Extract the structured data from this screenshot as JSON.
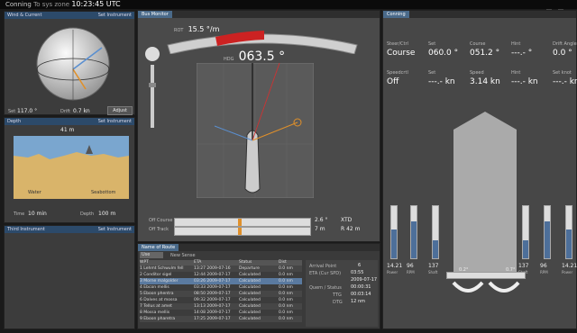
{
  "app": {
    "title": "Conning",
    "tz": "To sys zone",
    "time": "10:23:45 UTC"
  },
  "left": {
    "wind": {
      "header": "Wind & Current",
      "set_instr": "Set Instrument",
      "set_label": "Set",
      "set_value": "117.0 °",
      "drift_label": "Drift",
      "drift_value": "0.7 kn",
      "adjust": "Adjust"
    },
    "depth": {
      "header": "Depth",
      "set_instr": "Set Instrument",
      "depth_value": "41 m",
      "label_left": "Water",
      "label_right": "Seabottom",
      "time_label": "Time",
      "time_value": "10 min",
      "depth_label": "Depth",
      "depth_bottom": "100 m"
    },
    "third": {
      "header": "Third Instrument",
      "set_instr": "Set Instrument"
    }
  },
  "center": {
    "tab": "Bus Monitor",
    "rot": {
      "label": "ROT",
      "value": "15.5 °/m"
    },
    "heading": {
      "label": "HDG",
      "value": "063.5 °"
    },
    "xtd": {
      "off_course_label": "Off Course",
      "off_track_label": "Off Track",
      "course_val": "2.6 °",
      "track_val": "7 m",
      "xtd_label": "XTD",
      "xtd_val": "R 42 m"
    },
    "route": {
      "tab": "Name of Route",
      "dropdown": "Use",
      "header_label": "New Sense",
      "columns": [
        "WPT",
        "ETA",
        "Status",
        "Dist"
      ],
      "rows": [
        [
          "1 Lehmt Schwulm fell",
          "13:27 2009-07-16",
          "Departure",
          "0.0 nm"
        ],
        [
          "2 Conditor sigel",
          "12:44 2009-07-17",
          "Calculated",
          "0.0 nm"
        ],
        [
          "3 Morne malgolder",
          "03:26 2009-07-17",
          "Calculated",
          "0.0 nm"
        ],
        [
          "4 Ebcon mellis",
          "03:33 2009-07-17",
          "Calculated",
          "0.0 nm"
        ],
        [
          "5 Eboon phentra",
          "08:50 2009-07-17",
          "Calculated",
          "0.0 nm"
        ],
        [
          "6 Dalves at mossa",
          "09:32 2009-07-17",
          "Calculated",
          "0.0 nm"
        ],
        [
          "7 Tellus at amet",
          "13:13 2009-07-17",
          "Calculated",
          "0.0 nm"
        ],
        [
          "8 Mossa mellis",
          "14:08 2009-07-17",
          "Calculated",
          "0.0 nm"
        ],
        [
          "9 Eboon pharetra",
          "17:25 2009-07-17",
          "Calculated",
          "0.0 nm"
        ]
      ],
      "side": {
        "arrival_label": "Arrival Point",
        "arrival_val": "6",
        "eta_label": "ETA (Cur SPD)",
        "eta_val": "03:55",
        "date_val": "2009-07-17",
        "dur_label": "Quem / Status",
        "dur_val": "00:00:31",
        "ttg_label": "TTG",
        "ttg_val": "00:03:14",
        "dtg_label": "DTG",
        "dtg_val": "12 nm"
      }
    }
  },
  "right": {
    "tab": "Conning",
    "row1": [
      {
        "label": "Steer/Ctrl",
        "value": "Course"
      },
      {
        "label": "Set",
        "value": "060.0 °"
      },
      {
        "label": "Course",
        "value": "051.2 °"
      },
      {
        "label": "Hint",
        "value": "---.- °"
      },
      {
        "label": "Drift Angle",
        "value": "0.0 °"
      }
    ],
    "row2": [
      {
        "label": "Speedcrtl",
        "value": "Off"
      },
      {
        "label": "Set",
        "value": "---.- kn"
      },
      {
        "label": "Speed",
        "value": "3.14 kn"
      },
      {
        "label": "Hint",
        "value": "---.- kn"
      },
      {
        "label": "Set knot",
        "value": "---.- kn"
      }
    ],
    "gauges": [
      {
        "value": "14.21",
        "label": "Power",
        "fill": 0.55
      },
      {
        "value": "96",
        "label": "RPM",
        "fill": 0.7
      },
      {
        "value": "137",
        "label": "Shaft",
        "fill": 0.35
      },
      {
        "value": "137",
        "label": "Shaft",
        "fill": 0.35
      },
      {
        "value": "96",
        "label": "RPM",
        "fill": 0.7
      },
      {
        "value": "14.21",
        "label": "Power",
        "fill": 0.55
      }
    ],
    "rudder_left": "0.2°",
    "rudder_right": "0.7°"
  }
}
